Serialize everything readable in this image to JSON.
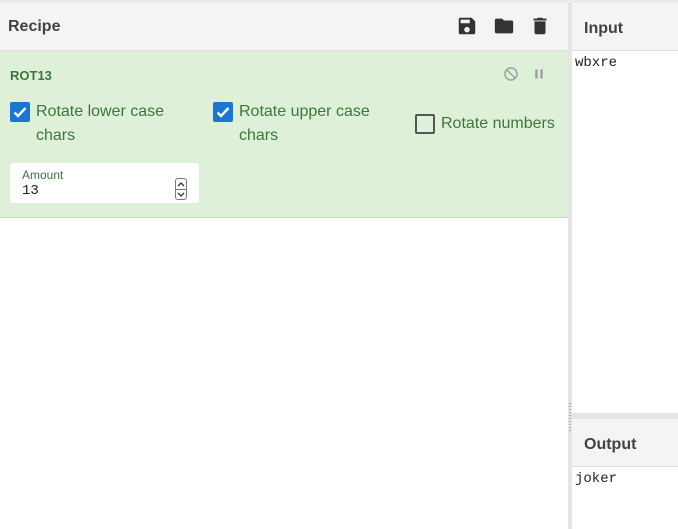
{
  "recipe": {
    "title": "Recipe",
    "icons": [
      "save-icon",
      "folder-icon",
      "trash-icon"
    ]
  },
  "operation": {
    "name": "ROT13",
    "controls": [
      "disable-icon",
      "pause-icon"
    ],
    "options": [
      {
        "label": "Rotate lower case\nchars",
        "checked": true
      },
      {
        "label": "Rotate upper case\nchars",
        "checked": true
      },
      {
        "label": "Rotate numbers",
        "checked": false
      }
    ],
    "amount": {
      "label": "Amount",
      "value": "13"
    }
  },
  "input": {
    "title": "Input",
    "value": "wbxre"
  },
  "output": {
    "title": "Output",
    "value": "joker"
  },
  "colors": {
    "operation_bg": "#dff0d8",
    "operation_text": "#3c763d",
    "checkbox_checked": "#1976d2",
    "header_bg": "#f4f4f4"
  }
}
